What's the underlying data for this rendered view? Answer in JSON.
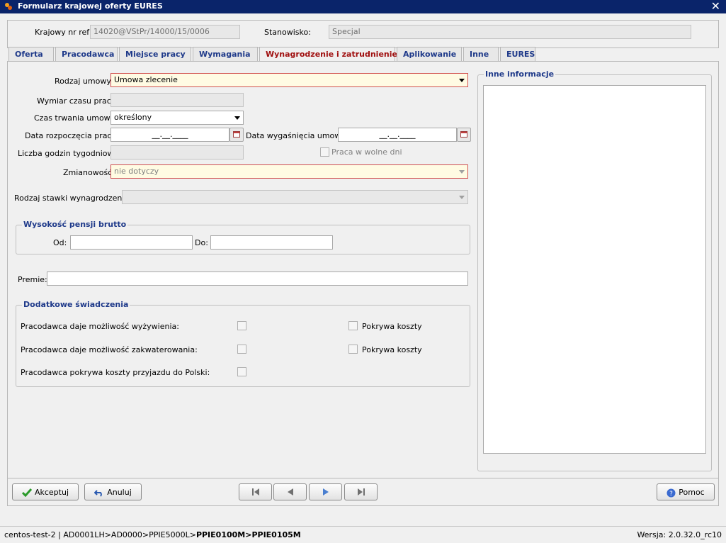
{
  "window": {
    "title": "Formularz krajowej oferty EURES",
    "close_glyph": "✕"
  },
  "header": {
    "ref_label": "Krajowy nr ref:",
    "ref_value": "14020@VStPr/14000/15/0006",
    "position_label": "Stanowisko:",
    "position_value": "Specjal"
  },
  "tabs": [
    {
      "label": "Oferta"
    },
    {
      "label": "Pracodawca"
    },
    {
      "label": "Miejsce pracy"
    },
    {
      "label": "Wymagania"
    },
    {
      "label": "Wynagrodzenie i zatrudnienie"
    },
    {
      "label": "Aplikowanie"
    },
    {
      "label": "Inne"
    },
    {
      "label": "EURES"
    }
  ],
  "active_tab": "Wynagrodzenie i zatrudnienie",
  "form": {
    "contract_type_label": "Rodzaj umowy:",
    "contract_type_value": "Umowa zlecenie",
    "working_time_label": "Wymiar czasu pracy:",
    "working_time_value": "",
    "contract_duration_label": "Czas trwania umowy:",
    "contract_duration_value": "określony",
    "start_date_label": "Data rozpoczęcia pracy:",
    "start_date_value": "__.__.____",
    "end_date_label": "Data wygaśnięcia umowy:",
    "end_date_value": "__.__.____",
    "weekly_hours_label": "Liczba godzin tygodniowo:",
    "weekly_hours_value": "",
    "days_off_label": "Praca w wolne dni",
    "shifts_label": "Zmianowość:",
    "shifts_value": "nie dotyczy",
    "rate_type_label": "Rodzaj stawki wynagrodzenia:",
    "rate_type_value": ""
  },
  "salary": {
    "title": "Wysokość pensji brutto",
    "from_label": "Od:",
    "from_value": "",
    "to_label": "Do:",
    "to_value": ""
  },
  "bonus": {
    "label": "Premie:",
    "value": ""
  },
  "benefits": {
    "title": "Dodatkowe świadczenia",
    "items": [
      {
        "label": "Pracodawca daje możliwość wyżywienia:",
        "covers_label": "Pokrywa koszty",
        "checked": false,
        "covers_checked": false
      },
      {
        "label": "Pracodawca daje możliwość zakwaterowania:",
        "covers_label": "Pokrywa koszty",
        "checked": false,
        "covers_checked": false
      },
      {
        "label": "Pracodawca pokrywa koszty przyjazdu do Polski:",
        "checked": false
      }
    ]
  },
  "other_info": {
    "title": "Inne informacje",
    "value": ""
  },
  "footer": {
    "accept_label": "Akceptuj",
    "cancel_label": "Anuluj",
    "help_label": "Pomoc"
  },
  "status": {
    "path_plain": "centos-test-2 | AD0001LH>AD0000>PPIE5000L>",
    "path_bold": "PPIE0100M>PPIE0105M",
    "version": "Wersja: 2.0.32.0_rc10"
  },
  "colors": {
    "accent": "#1f3a8a",
    "active_tab": "#a01010",
    "required_border": "#d05050",
    "required_bg": "#fffbe3",
    "titlebar": "#0a246a"
  }
}
